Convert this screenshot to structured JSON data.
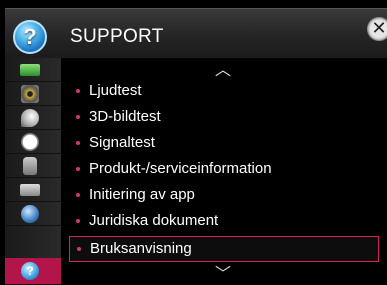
{
  "header": {
    "title": "SUPPORT",
    "help_icon_glyph": "?",
    "close_glyph": "✕"
  },
  "sidebar": {
    "items": [
      {
        "icon": "picture-icon"
      },
      {
        "icon": "sound-icon"
      },
      {
        "icon": "satellite-dish-icon"
      },
      {
        "icon": "clock-icon"
      },
      {
        "icon": "lock-icon"
      },
      {
        "icon": "keyboard-icon"
      },
      {
        "icon": "network-icon"
      },
      {
        "icon": "help-icon",
        "glyph": "?",
        "active": true
      }
    ]
  },
  "menu": {
    "scroll_up_glyph": "︿",
    "scroll_down_glyph": "﹀",
    "items": [
      {
        "label": "Ljudtest"
      },
      {
        "label": "3D-bildtest"
      },
      {
        "label": "Signaltest"
      },
      {
        "label": "Produkt-/serviceinformation"
      },
      {
        "label": "Initiering av app"
      },
      {
        "label": "Juridiska dokument"
      },
      {
        "label": "Bruksanvisning",
        "selected": true
      }
    ]
  },
  "colors": {
    "accent": "#d2245c",
    "active_sidebar": "#b3154a",
    "bullet": "#d43770",
    "text": "#ffffff"
  }
}
